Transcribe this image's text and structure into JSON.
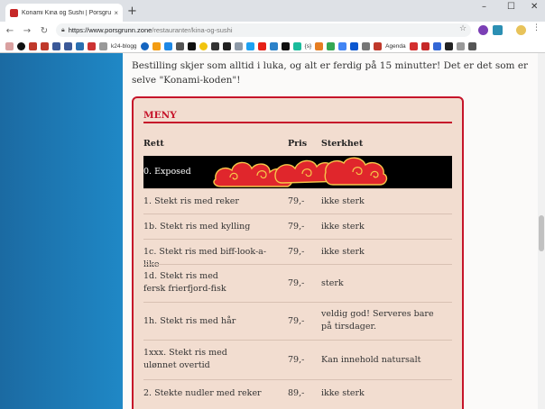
{
  "browser": {
    "tab_title": "Konami Kina og Sushi | Porsgrunn...",
    "tab_close": "×",
    "new_tab": "+",
    "url_domain": "https://www.porsgrunn.zone",
    "url_path": "/restauranter/kina-og-sushi",
    "bookmarks": {
      "k24": "k24-blogg",
      "agenda": "Agenda",
      "code": "{s}"
    },
    "window_controls": {
      "minimize": "–",
      "maximize": "☐",
      "close": "✕"
    }
  },
  "page": {
    "intro": "Bestilling skjer som alltid i luka, og alt er ferdig på 15 minutter! Det er det som er selve \"Konami-koden\"!",
    "menu_title": "MENY",
    "headers": {
      "rett": "Rett",
      "pris": "Pris",
      "sterkhet": "Sterkhet"
    },
    "exposed_label": "0. Exposed",
    "rows": [
      {
        "rett": "1. Stekt ris med reker",
        "pris": "79,-",
        "sterkhet": "ikke sterk"
      },
      {
        "rett": "1b. Stekt ris med kylling",
        "pris": "79,-",
        "sterkhet": "ikke sterk"
      },
      {
        "rett": "1c. Stekt ris med biff-look-a-like",
        "pris": "79,-",
        "sterkhet": "ikke sterk"
      },
      {
        "rett": "1d. Stekt ris med fersk frierfjord-fisk",
        "pris": "79,-",
        "sterkhet": "sterk"
      },
      {
        "rett": "1h. Stekt ris med hår",
        "pris": "79,-",
        "sterkhet": "veldig god! Serveres bare på tirsdager."
      },
      {
        "rett": "1xxx. Stekt ris med ulønnet overtid",
        "pris": "79,-",
        "sterkhet": "Kan innehold natursalt"
      },
      {
        "rett": "2. Stekte nudler med reker",
        "pris": "89,-",
        "sterkhet": "ikke sterk"
      }
    ]
  },
  "colors": {
    "accent": "#c6142a",
    "card_bg": "#f2ddd0",
    "page_bg": "#1d6fa5"
  }
}
